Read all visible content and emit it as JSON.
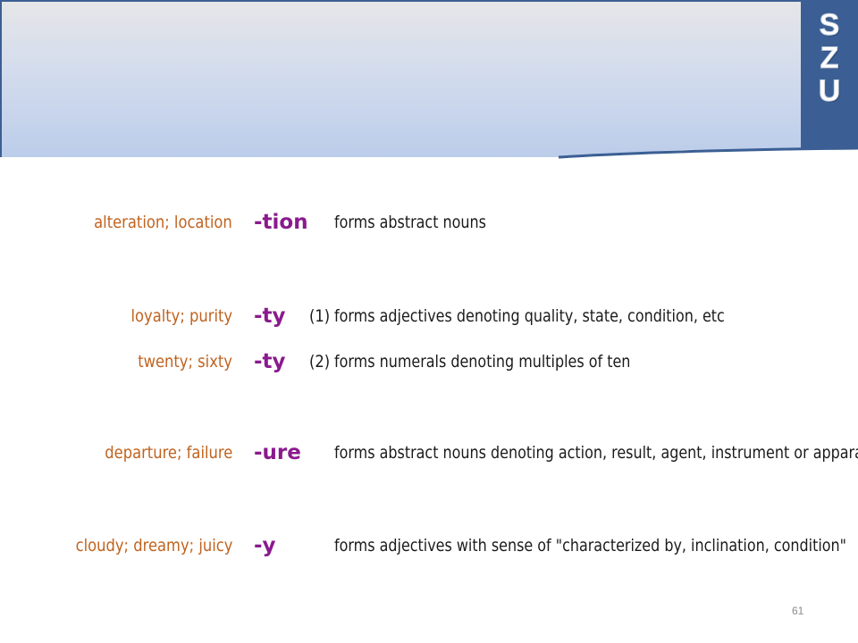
{
  "logo": {
    "letters": [
      "S",
      "Z",
      "U"
    ]
  },
  "rows": [
    {
      "example": "alteration; location",
      "suffix": "-tion",
      "num": "",
      "desc": "forms abstract nouns"
    },
    {
      "example": "loyalty; purity",
      "suffix": "-ty",
      "num": "(1)",
      "desc": "forms adjectives denoting quality, state, condition, etc"
    },
    {
      "example": "twenty; sixty",
      "suffix": "-ty",
      "num": "(2)",
      "desc": "forms numerals denoting multiples of ten"
    },
    {
      "example": "departure; failure",
      "suffix": "-ure",
      "num": "",
      "desc": "forms abstract nouns denoting action, result, agent, instrument or apparatus"
    },
    {
      "example": "cloudy; dreamy; juicy",
      "suffix": "-y",
      "num": "",
      "desc": "forms adjectives with sense of \"characterized by, inclination, condition\""
    }
  ],
  "page_number": "61",
  "colors": {
    "example_text": "#c0621e",
    "suffix_text": "#8a1a8e",
    "description_text": "#1a1a1a",
    "logo_background": "#3b5f94"
  }
}
